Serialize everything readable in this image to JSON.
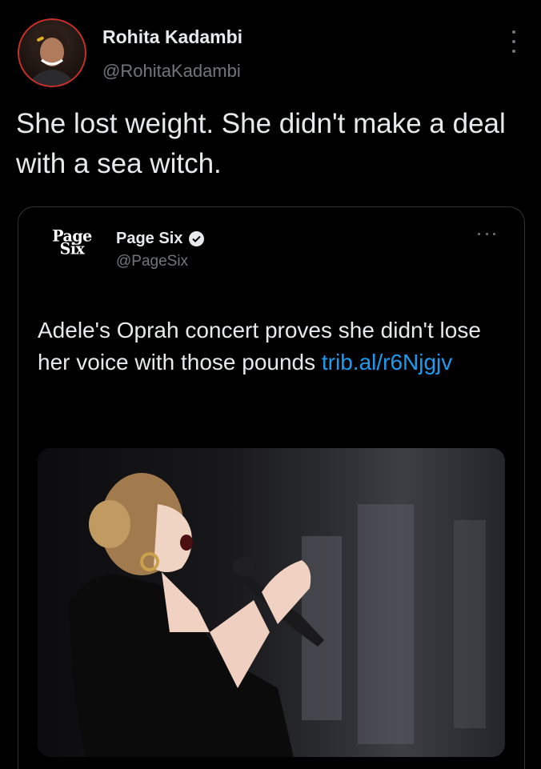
{
  "tweet": {
    "author_name": "Rohita Kadambi",
    "author_handle": "@RohitaKadambi",
    "text": "She lost weight. She didn't make a deal with a sea witch."
  },
  "quote": {
    "logo_line1": "Page",
    "logo_line2": "Six",
    "name": "Page Six",
    "handle": "@PageSix",
    "text": "Adele's Oprah concert proves she didn't lose her voice with those pounds ",
    "link": "trib.al/r6Njgjv"
  },
  "icons": {
    "more": "more-vertical-icon",
    "quote_more": "more-horizontal-icon",
    "verified": "verified-badge-icon"
  },
  "colors": {
    "background": "#000000",
    "primary_text": "#e7e9ea",
    "secondary_text": "#71767b",
    "link": "#1d9bf0",
    "border": "#2f3336"
  }
}
